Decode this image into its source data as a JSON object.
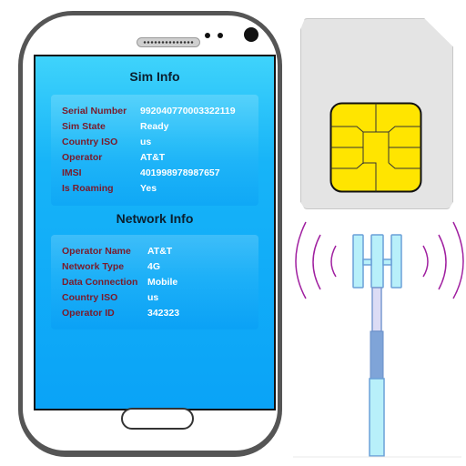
{
  "sim_info": {
    "title": "Sim Info",
    "rows": [
      {
        "label": "Serial Number",
        "value": "992040770003322119"
      },
      {
        "label": "Sim State",
        "value": "Ready"
      },
      {
        "label": "Country ISO",
        "value": "us"
      },
      {
        "label": "Operator",
        "value": "AT&T"
      },
      {
        "label": "IMSI",
        "value": "401998978987657"
      },
      {
        "label": "Is Roaming",
        "value": "Yes"
      }
    ]
  },
  "network_info": {
    "title": "Network Info",
    "rows": [
      {
        "label": "Operator Name",
        "value": "AT&T"
      },
      {
        "label": "Network Type",
        "value": "4G"
      },
      {
        "label": "Data Connection",
        "value": "Mobile"
      },
      {
        "label": "Country ISO",
        "value": "us"
      },
      {
        "label": "Operator ID",
        "value": "342323"
      }
    ]
  },
  "icons": {
    "sim_card": "sim-card-icon",
    "cell_tower": "cell-tower-icon"
  },
  "colors": {
    "screen_top": "#3fd3fb",
    "screen_bottom": "#0aa3f7",
    "label": "#7a1a2a",
    "value": "#ffffff",
    "chip": "#ffe500",
    "signal_waves": "#a020a0"
  }
}
